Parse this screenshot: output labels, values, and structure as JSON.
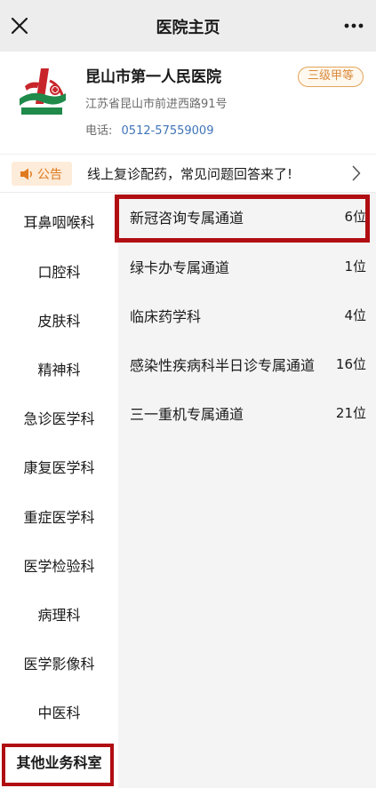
{
  "navbar": {
    "title": "医院主页",
    "close_icon": "close-icon",
    "more_icon": "more-dots-icon"
  },
  "hospital": {
    "name": "昆山市第一人民医院",
    "grade": "三级甲等",
    "address": "江苏省昆山市前进西路91号",
    "phone_label": "电话:",
    "phone": "0512-57559009"
  },
  "notice": {
    "tag": "公告",
    "text": "线上复诊配药，常见问题回答来了!",
    "tag_color": "#e07a1f"
  },
  "sidebar": {
    "items": [
      {
        "label": "耳鼻咽喉科"
      },
      {
        "label": "口腔科"
      },
      {
        "label": "皮肤科"
      },
      {
        "label": "精神科"
      },
      {
        "label": "急诊医学科"
      },
      {
        "label": "康复医学科"
      },
      {
        "label": "重症医学科"
      },
      {
        "label": "医学检验科"
      },
      {
        "label": "病理科"
      },
      {
        "label": "医学影像科"
      },
      {
        "label": "中医科"
      },
      {
        "label": "其他业务科室"
      }
    ],
    "selected_index": 11
  },
  "services": [
    {
      "name": "新冠咨询专属通道",
      "count": "6位"
    },
    {
      "name": "绿卡办专属通道",
      "count": "1位"
    },
    {
      "name": "临床药学科",
      "count": "4位"
    },
    {
      "name": "感染性疾病科半日诊专属通道",
      "count": "16位"
    },
    {
      "name": "三一重机专属通道",
      "count": "21位"
    }
  ],
  "colors": {
    "highlight": "#b00e12",
    "link": "#3f74b8",
    "badge": "#d8893a"
  }
}
